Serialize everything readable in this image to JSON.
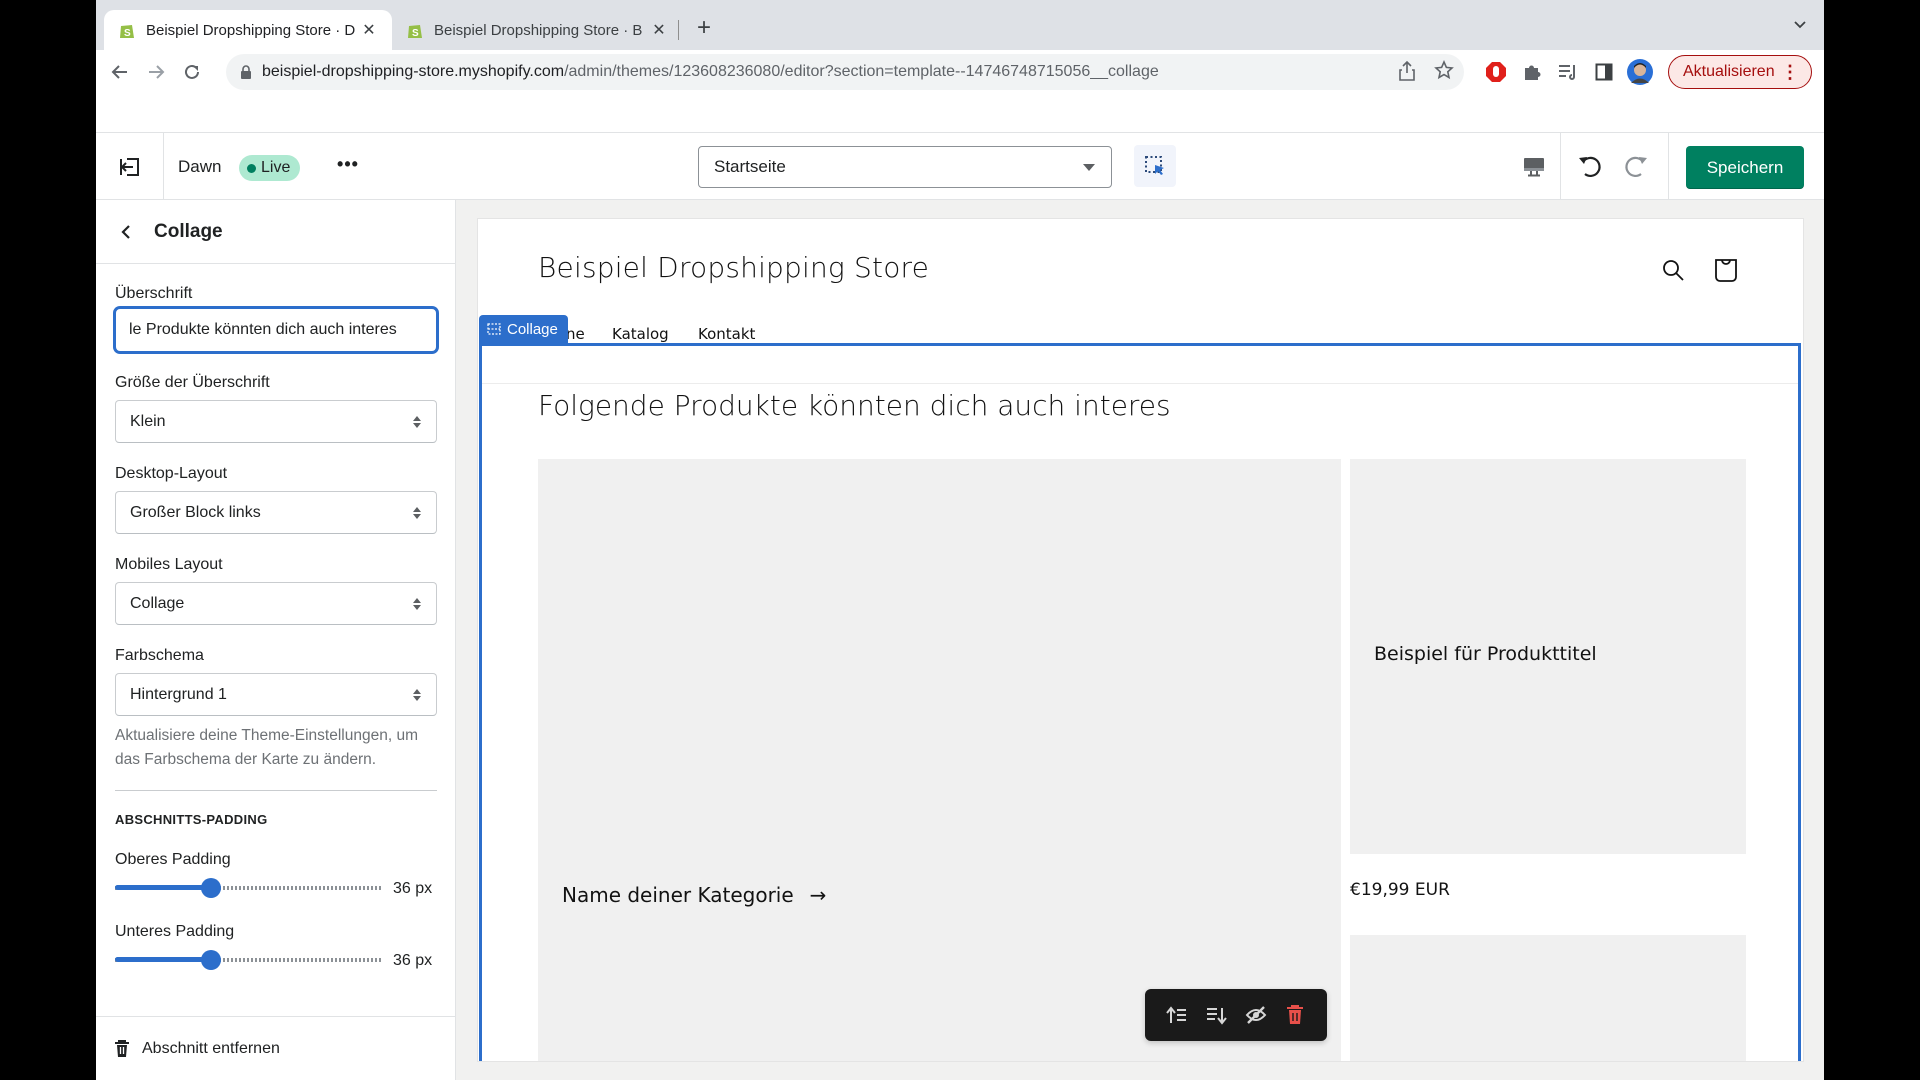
{
  "browser": {
    "tabs": [
      {
        "title": "Beispiel Dropshipping Store · D",
        "active": true
      },
      {
        "title": "Beispiel Dropshipping Store · B",
        "active": false
      }
    ],
    "close_glyph": "✕",
    "new_tab_glyph": "+",
    "tab_menu_glyph": "⌄",
    "url_host": "beispiel-dropshipping-store.myshopify.com",
    "url_path": "/admin/themes/123608236080/editor?section=template--14746748715056__collage",
    "update_button": "Aktualisieren",
    "update_menu_glyph": "⋮",
    "colors": {
      "update_red": "#a50e0e"
    }
  },
  "editor": {
    "theme_name": "Dawn",
    "status_badge": "Live",
    "more_glyph": "•••",
    "page_selector": "Startseite",
    "save_label": "Speichern",
    "colors": {
      "primary": "#008060",
      "focus_blue": "#2c6ecb",
      "live_badge": "#aee9d1"
    }
  },
  "sidebar": {
    "title": "Collage",
    "fields": {
      "heading_label": "Überschrift",
      "heading_value": "le Produkte könnten dich auch interes",
      "heading_size_label": "Größe der Überschrift",
      "heading_size_value": "Klein",
      "desktop_layout_label": "Desktop-Layout",
      "desktop_layout_value": "Großer Block links",
      "mobile_layout_label": "Mobiles Layout",
      "mobile_layout_value": "Collage",
      "color_scheme_label": "Farbschema",
      "color_scheme_value": "Hintergrund 1",
      "color_scheme_help": "Aktualisiere deine Theme-Einstellungen, um das Farbschema der Karte zu ändern."
    },
    "padding_section": {
      "heading": "ABSCHNITTS-PADDING",
      "top_label": "Oberes Padding",
      "top_value": 36,
      "top_value_text": "36 px",
      "bottom_label": "Unteres Padding",
      "bottom_value": 36,
      "bottom_value_text": "36 px",
      "range_min": 0,
      "range_max": 100
    },
    "remove_section": "Abschnitt entfernen"
  },
  "preview": {
    "store_name": "Beispiel Dropshipping Store",
    "nav": [
      "ne",
      "Katalog",
      "Kontakt"
    ],
    "section_tag": "Collage",
    "collage_heading": "Folgende Produkte könnten dich auch interes",
    "category_link": "Name deiner Kategorie",
    "arrow_glyph": "→",
    "product_title": "Beispiel für Produkttitel",
    "price": "€19,99 EUR"
  }
}
